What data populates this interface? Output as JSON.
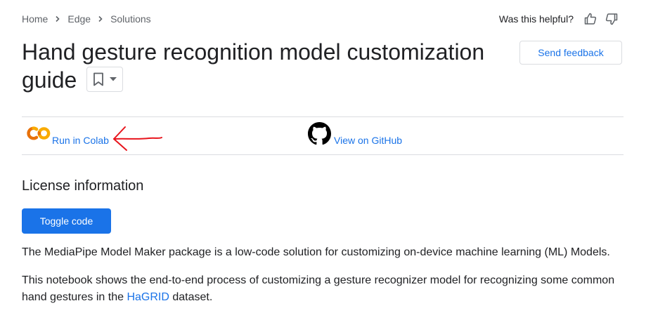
{
  "breadcrumb": {
    "items": [
      "Home",
      "Edge",
      "Solutions"
    ],
    "separator_icon": "chevron-right-icon"
  },
  "feedback_prompt": {
    "label": "Was this helpful?",
    "icons": [
      "thumb-up-icon",
      "thumb-down-icon"
    ]
  },
  "page": {
    "title": "Hand gesture recognition model customization guide",
    "bookmark_icon": "bookmark-icon",
    "dropdown_icon": "caret-down-icon",
    "send_feedback_label": "Send feedback"
  },
  "links": {
    "colab_label": "Run in Colab",
    "colab_icon": "colab-logo-icon",
    "github_label": "View on GitHub",
    "github_icon": "github-logo-icon",
    "annotation_icon": "red-arrow-annotation"
  },
  "content": {
    "section_heading": "License information",
    "toggle_label": "Toggle code",
    "paragraph1": "The MediaPipe Model Maker package is a low-code solution for customizing on-device machine learning (ML) Models.",
    "paragraph2_before": "This notebook shows the end-to-end process of customizing a gesture recognizer model for recognizing some common hand gestures in the",
    "paragraph2_link": "HaGRID",
    "paragraph2_after": "dataset."
  },
  "colors": {
    "link": "#1a73e8",
    "primary_button": "#1a73e8",
    "text": "#202124",
    "muted": "#5f6368",
    "divider": "#dadce0",
    "colab_orange": "#f9ab00",
    "colab_dark_orange": "#e8710a",
    "annotation_red": "#e8141c"
  }
}
